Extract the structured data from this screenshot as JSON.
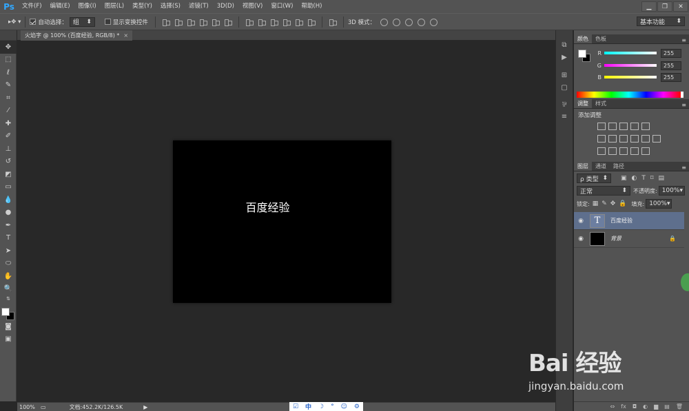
{
  "app": {
    "logo": "Ps"
  },
  "menu": [
    "文件(F)",
    "编辑(E)",
    "图像(I)",
    "图层(L)",
    "类型(Y)",
    "选择(S)",
    "滤镜(T)",
    "3D(D)",
    "视图(V)",
    "窗口(W)",
    "帮助(H)"
  ],
  "window_controls": {
    "minimize": "▁",
    "restore": "❐",
    "close": "✕"
  },
  "options": {
    "auto_select_label": "自动选择：",
    "auto_select_checked": true,
    "auto_select_target": "组",
    "show_transform_label": "显示变换控件",
    "show_transform_checked": false,
    "mode_3d_label": "3D 模式：",
    "workspace": "基本功能"
  },
  "document": {
    "tab_title": "火焰字 @ 100% (百度经验, RGB/8) *",
    "tab_close": "×",
    "canvas_text": "百度经验",
    "zoom": "100%",
    "doc_info": "文档:452.2K/126.5K",
    "status_arrow": "▶"
  },
  "ime": [
    "☑",
    "中",
    "☽",
    "°",
    "☺",
    "⚙"
  ],
  "panels": {
    "color_tabs": [
      "颜色",
      "色板"
    ],
    "rgb": [
      {
        "label": "R",
        "value": "255",
        "color": "#00ffff"
      },
      {
        "label": "G",
        "value": "255",
        "color": "#ff00ff"
      },
      {
        "label": "B",
        "value": "255",
        "color": "#ffff00"
      }
    ],
    "adjust_tabs": [
      "调整",
      "样式"
    ],
    "adjust_title": "添加调整",
    "layers_tabs": [
      "图层",
      "通道",
      "路径"
    ],
    "filter_kind": "ρ 类型",
    "blend_mode": "正常",
    "opacity_label": "不透明度:",
    "opacity_value": "100%",
    "lock_label": "锁定:",
    "fill_label": "填充:",
    "fill_value": "100%",
    "layers": [
      {
        "name": "百度经验",
        "type": "text",
        "selected": true
      },
      {
        "name": "背景",
        "type": "background",
        "selected": false
      }
    ],
    "footer_icons": [
      "⇔",
      "fx",
      "◘",
      "◐",
      "▆",
      "▤",
      "🗑"
    ]
  },
  "watermark": {
    "logo": "Bai 经验",
    "url": "jingyan.baidu.com"
  }
}
